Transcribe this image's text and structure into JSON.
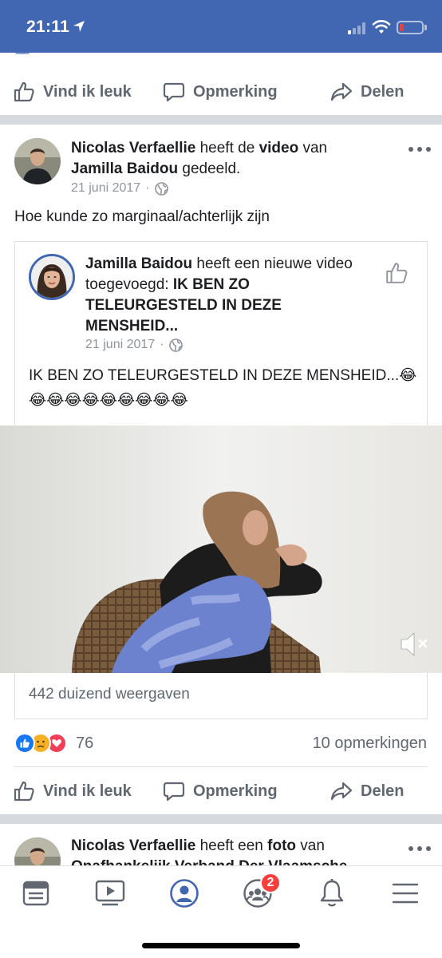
{
  "status_bar": {
    "time": "21:11"
  },
  "top_actions": {
    "like": "Vind ik leuk",
    "comment": "Opmerking",
    "share": "Delen"
  },
  "post": {
    "author": "Nicolas Verfaellie",
    "verb_before": "heeft de",
    "object": "video",
    "verb_mid": "van",
    "target": "Jamilla Baidou",
    "verb_after": "gedeeld.",
    "date": "21 juni 2017",
    "text": "Hoe kunde zo marginaal/achterlijk zijn",
    "shared": {
      "author": "Jamilla Baidou",
      "verb": "heeft een nieuwe video toegevoegd:",
      "title": "IK BEN ZO TELEURGESTELD IN DEZE MENSHEID...",
      "date": "21 juni 2017",
      "text": "IK BEN ZO TELEURGESTELD IN DEZE MENSHEID...😂😂😂😂😂😂😂😂😂😂"
    },
    "views": "442 duizend weergaven",
    "reaction_count": "76",
    "comments": "10 opmerkingen"
  },
  "bottom_actions": {
    "like": "Vind ik leuk",
    "comment": "Opmerking",
    "share": "Delen"
  },
  "next_post": {
    "author": "Nicolas Verfaellie",
    "verb": "heeft een",
    "object": "foto",
    "verb_mid": "van",
    "target": "Onafhankelijk Verband Der Vlaamsche"
  },
  "tabbar": {
    "groups_badge": "2"
  },
  "colors": {
    "brand": "#4267b2",
    "text": "#1c1e21",
    "muted": "#606770",
    "meta": "#90949c",
    "badge": "#fa3e3e",
    "like": "#1877f2",
    "love": "#f33e58",
    "haha": "#f7b125"
  },
  "icons": [
    "location-arrow-icon",
    "signal-icon",
    "wifi-icon",
    "battery-icon",
    "like-icon",
    "comment-icon",
    "share-icon",
    "globe-icon",
    "more-icon",
    "mute-icon",
    "news-feed-icon",
    "video-icon",
    "profile-icon",
    "groups-icon",
    "bell-icon",
    "menu-icon"
  ]
}
